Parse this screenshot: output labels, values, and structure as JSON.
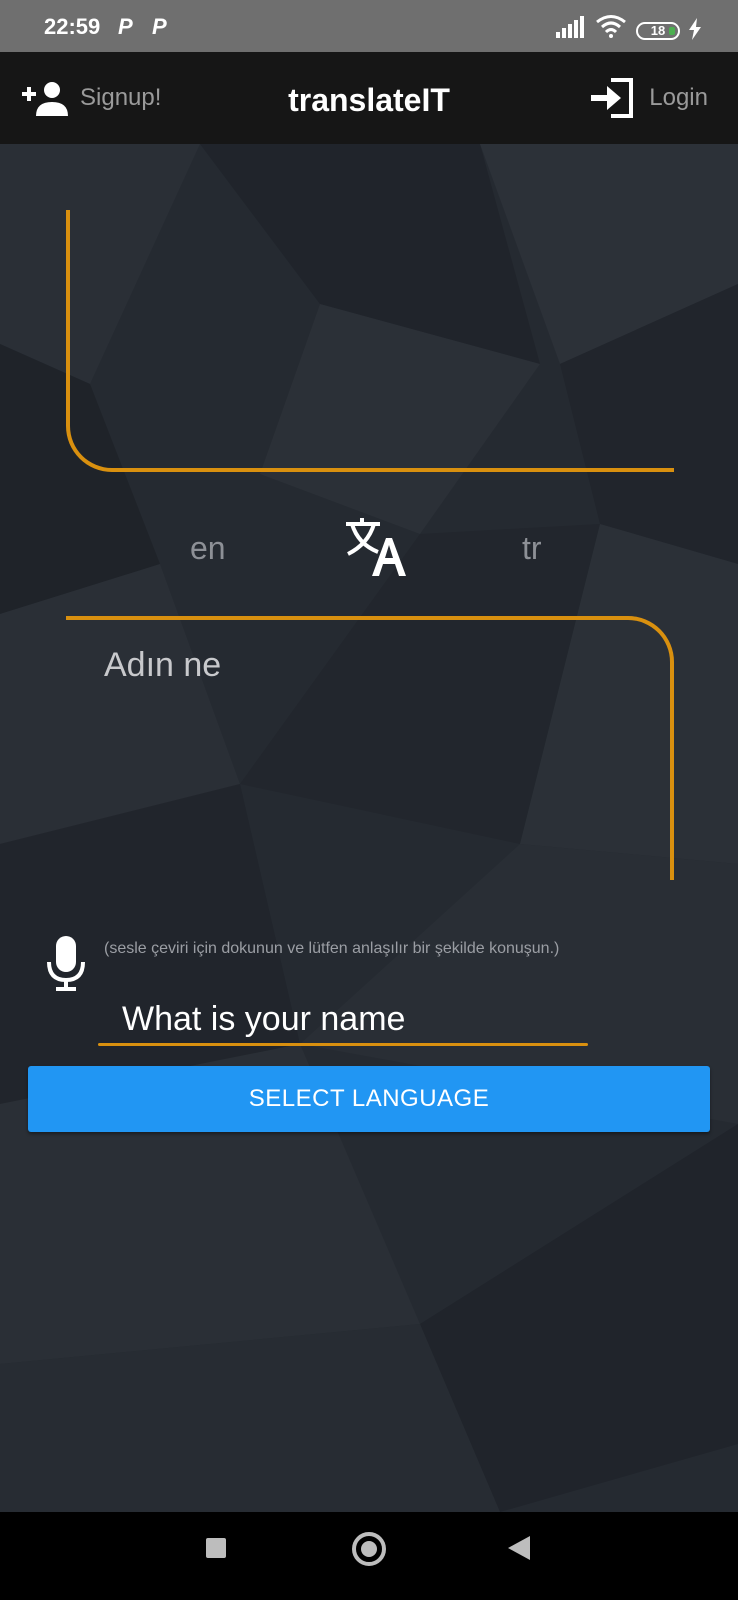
{
  "status_bar": {
    "time": "22:59",
    "notification_icons": [
      "P",
      "P"
    ],
    "battery_level": "18",
    "icons": [
      "signal-icon",
      "wifi-icon",
      "battery-icon",
      "charging-bolt-icon"
    ]
  },
  "app_bar": {
    "title": "translateIT",
    "signup_label": "Signup!",
    "login_label": "Login",
    "signup_icon": "add-person-icon",
    "login_icon": "login-icon"
  },
  "translator": {
    "source_text": "",
    "source_language": "en",
    "target_language": "tr",
    "swap_icon": "translate-icon",
    "translated_text": "Adın ne"
  },
  "voice": {
    "icon": "microphone-icon",
    "hint": "(sesle çeviri için dokunun ve lütfen anlaşılır bir şekilde konuşun.)"
  },
  "input": {
    "value": "What is your name"
  },
  "select_button": {
    "label": "SELECT LANGUAGE"
  },
  "colors": {
    "accent": "#d9900f",
    "button": "#2196f3",
    "background": "#252a31",
    "app_bar": "#161616"
  },
  "navigation_bar": {
    "icons": [
      "recents-icon",
      "home-icon",
      "back-icon"
    ]
  }
}
